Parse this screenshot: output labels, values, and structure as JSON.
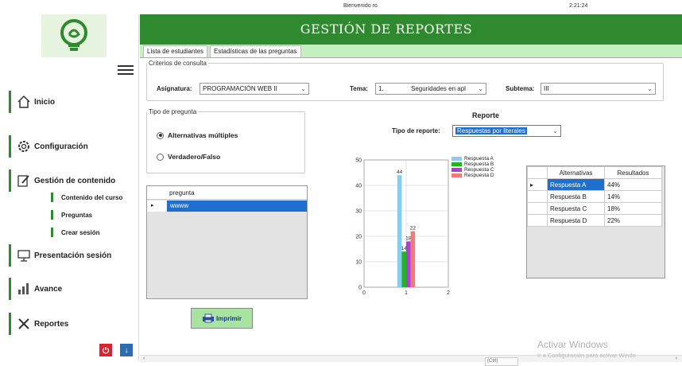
{
  "topbar": {
    "welcome": "Bienvenido ro",
    "clock": "2:21:24"
  },
  "header": {
    "title": "GESTIÓN DE REPORTES"
  },
  "tabs": [
    {
      "label": "Lista de estudiantes"
    },
    {
      "label": "Estadísticas de las preguntas"
    }
  ],
  "sidebar": {
    "items": [
      {
        "label": "Inicio",
        "icon": "home-icon"
      },
      {
        "label": "Configuración",
        "icon": "gear-icon"
      },
      {
        "label": "Gestión de contenido",
        "icon": "edit-document-icon"
      },
      {
        "label": "Presentación sesión",
        "icon": "presentation-icon"
      },
      {
        "label": "Avance",
        "icon": "progress-icon"
      },
      {
        "label": "Reportes",
        "icon": "tools-icon"
      }
    ],
    "subitems": [
      {
        "label": "Contenido del curso"
      },
      {
        "label": "Preguntas"
      },
      {
        "label": "Crear sesión"
      }
    ]
  },
  "criteria": {
    "legend": "Criterios de consulta",
    "asignatura_label": "Asignatura:",
    "asignatura_value": "PROGRAMACIÓN WEB II",
    "tema_label": "Tema:",
    "tema_number": "1.",
    "tema_value": "Seguridades en apl",
    "subtema_label": "Subtema:",
    "subtema_value": "III"
  },
  "question_type": {
    "legend": "Tipo de pregunta",
    "options": [
      {
        "label": "Alternativas múltiples",
        "selected": true
      },
      {
        "label": "Verdadero/Falso",
        "selected": false
      }
    ]
  },
  "questions_grid": {
    "column": "pregunta",
    "rows": [
      "wwww"
    ]
  },
  "print_button": {
    "label": "Imprimir"
  },
  "report": {
    "title": "Reporte",
    "type_label": "Tipo de reporte:",
    "type_value": "Respuestas por literales"
  },
  "chart_data": {
    "type": "bar",
    "title": "",
    "xlabel": "",
    "ylabel": "",
    "xlim": [
      0,
      2
    ],
    "ylim": [
      0,
      50
    ],
    "x_ticks": [
      0,
      1,
      2
    ],
    "y_ticks": [
      0,
      10,
      20,
      30,
      40,
      50
    ],
    "grid": true,
    "legend_position": "right",
    "series": [
      {
        "name": "Respuesta A",
        "values": [
          44
        ],
        "color": "#87ceeb"
      },
      {
        "name": "Respuesta B",
        "values": [
          14
        ],
        "color": "#22b422"
      },
      {
        "name": "Respuesta C",
        "values": [
          18
        ],
        "color": "#b03fd1"
      },
      {
        "name": "Respuesta D",
        "values": [
          22
        ],
        "color": "#f07a7a"
      }
    ]
  },
  "results_table": {
    "headers": [
      "Alternativas",
      "Resultados"
    ],
    "rows": [
      [
        "Respuesta A",
        "44%"
      ],
      [
        "Respuesta B",
        "14%"
      ],
      [
        "Respuesta C",
        "18%"
      ],
      [
        "Respuesta D",
        "22%"
      ]
    ]
  },
  "watermark": {
    "line1": "Activar Windows",
    "line2": "Ir a Configuración para activar Windo"
  },
  "ctrl_hint": "(Ctrl)"
}
